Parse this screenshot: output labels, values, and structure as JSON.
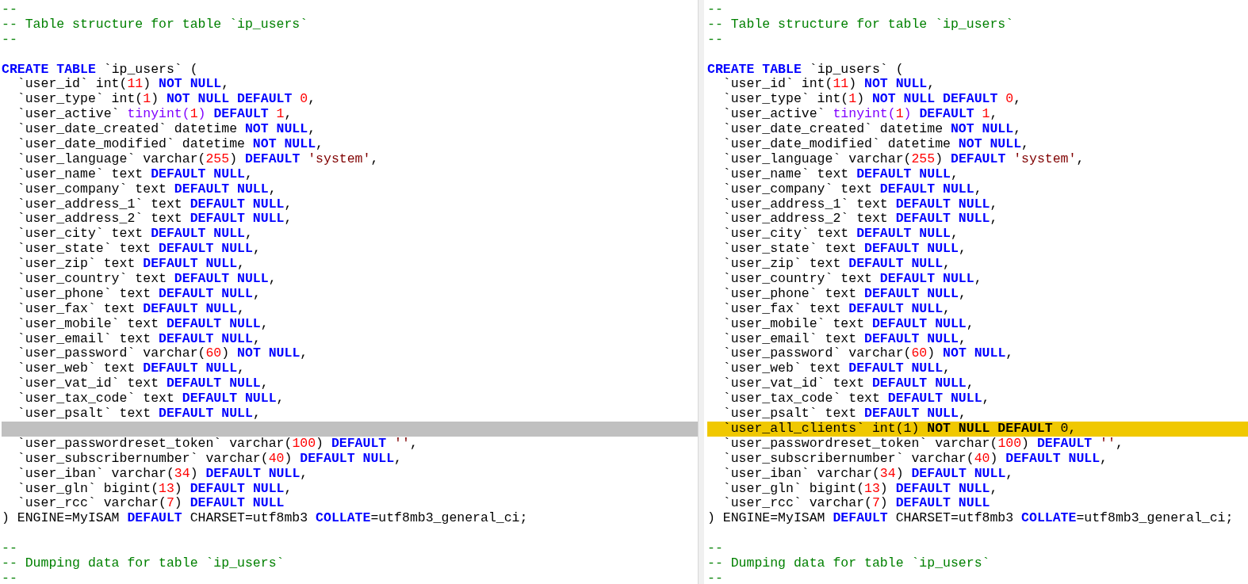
{
  "panes": [
    {
      "lines": [
        {
          "kind": "code",
          "tokens": [
            {
              "kind": "comment",
              "text": "--"
            }
          ]
        },
        {
          "kind": "code",
          "tokens": [
            {
              "kind": "comment",
              "text": "-- Table structure for table `ip_users`"
            }
          ]
        },
        {
          "kind": "code",
          "tokens": [
            {
              "kind": "comment",
              "text": "--"
            }
          ]
        },
        {
          "kind": "blank"
        },
        {
          "kind": "code",
          "tokens": [
            {
              "kind": "kw",
              "text": "CREATE TABLE"
            },
            {
              "kind": "plain",
              "text": " `ip_users` ("
            }
          ]
        },
        {
          "kind": "code",
          "tokens": [
            {
              "kind": "plain",
              "text": "  `user_id` int("
            },
            {
              "kind": "num",
              "text": "11"
            },
            {
              "kind": "plain",
              "text": ") "
            },
            {
              "kind": "kw",
              "text": "NOT NULL"
            },
            {
              "kind": "plain",
              "text": ","
            }
          ]
        },
        {
          "kind": "code",
          "tokens": [
            {
              "kind": "plain",
              "text": "  `user_type` int("
            },
            {
              "kind": "num",
              "text": "1"
            },
            {
              "kind": "plain",
              "text": ") "
            },
            {
              "kind": "kw",
              "text": "NOT NULL DEFAULT"
            },
            {
              "kind": "num",
              "text": " 0"
            },
            {
              "kind": "plain",
              "text": ","
            }
          ]
        },
        {
          "kind": "code",
          "tokens": [
            {
              "kind": "plain",
              "text": "  `user_active` "
            },
            {
              "kind": "type",
              "text": "tinyint("
            },
            {
              "kind": "num",
              "text": "1"
            },
            {
              "kind": "type",
              "text": ") "
            },
            {
              "kind": "kw",
              "text": "DEFAULT"
            },
            {
              "kind": "num",
              "text": " 1"
            },
            {
              "kind": "plain",
              "text": ","
            }
          ]
        },
        {
          "kind": "code",
          "tokens": [
            {
              "kind": "plain",
              "text": "  `user_date_created` datetime "
            },
            {
              "kind": "kw",
              "text": "NOT NULL"
            },
            {
              "kind": "plain",
              "text": ","
            }
          ]
        },
        {
          "kind": "code",
          "tokens": [
            {
              "kind": "plain",
              "text": "  `user_date_modified` datetime "
            },
            {
              "kind": "kw",
              "text": "NOT NULL"
            },
            {
              "kind": "plain",
              "text": ","
            }
          ]
        },
        {
          "kind": "code",
          "tokens": [
            {
              "kind": "plain",
              "text": "  `user_language` varchar("
            },
            {
              "kind": "num",
              "text": "255"
            },
            {
              "kind": "plain",
              "text": ") "
            },
            {
              "kind": "kw",
              "text": "DEFAULT"
            },
            {
              "kind": "str",
              "text": " 'system'"
            },
            {
              "kind": "plain",
              "text": ","
            }
          ]
        },
        {
          "kind": "code",
          "tokens": [
            {
              "kind": "plain",
              "text": "  `user_name` text "
            },
            {
              "kind": "kw",
              "text": "DEFAULT NULL"
            },
            {
              "kind": "plain",
              "text": ","
            }
          ]
        },
        {
          "kind": "code",
          "tokens": [
            {
              "kind": "plain",
              "text": "  `user_company` text "
            },
            {
              "kind": "kw",
              "text": "DEFAULT NULL"
            },
            {
              "kind": "plain",
              "text": ","
            }
          ]
        },
        {
          "kind": "code",
          "tokens": [
            {
              "kind": "plain",
              "text": "  `user_address_1` text "
            },
            {
              "kind": "kw",
              "text": "DEFAULT NULL"
            },
            {
              "kind": "plain",
              "text": ","
            }
          ]
        },
        {
          "kind": "code",
          "tokens": [
            {
              "kind": "plain",
              "text": "  `user_address_2` text "
            },
            {
              "kind": "kw",
              "text": "DEFAULT NULL"
            },
            {
              "kind": "plain",
              "text": ","
            }
          ]
        },
        {
          "kind": "code",
          "tokens": [
            {
              "kind": "plain",
              "text": "  `user_city` text "
            },
            {
              "kind": "kw",
              "text": "DEFAULT NULL"
            },
            {
              "kind": "plain",
              "text": ","
            }
          ]
        },
        {
          "kind": "code",
          "tokens": [
            {
              "kind": "plain",
              "text": "  `user_state` text "
            },
            {
              "kind": "kw",
              "text": "DEFAULT NULL"
            },
            {
              "kind": "plain",
              "text": ","
            }
          ]
        },
        {
          "kind": "code",
          "tokens": [
            {
              "kind": "plain",
              "text": "  `user_zip` text "
            },
            {
              "kind": "kw",
              "text": "DEFAULT NULL"
            },
            {
              "kind": "plain",
              "text": ","
            }
          ]
        },
        {
          "kind": "code",
          "tokens": [
            {
              "kind": "plain",
              "text": "  `user_country` text "
            },
            {
              "kind": "kw",
              "text": "DEFAULT NULL"
            },
            {
              "kind": "plain",
              "text": ","
            }
          ]
        },
        {
          "kind": "code",
          "tokens": [
            {
              "kind": "plain",
              "text": "  `user_phone` text "
            },
            {
              "kind": "kw",
              "text": "DEFAULT NULL"
            },
            {
              "kind": "plain",
              "text": ","
            }
          ]
        },
        {
          "kind": "code",
          "tokens": [
            {
              "kind": "plain",
              "text": "  `user_fax` text "
            },
            {
              "kind": "kw",
              "text": "DEFAULT NULL"
            },
            {
              "kind": "plain",
              "text": ","
            }
          ]
        },
        {
          "kind": "code",
          "tokens": [
            {
              "kind": "plain",
              "text": "  `user_mobile` text "
            },
            {
              "kind": "kw",
              "text": "DEFAULT NULL"
            },
            {
              "kind": "plain",
              "text": ","
            }
          ]
        },
        {
          "kind": "code",
          "tokens": [
            {
              "kind": "plain",
              "text": "  `user_email` text "
            },
            {
              "kind": "kw",
              "text": "DEFAULT NULL"
            },
            {
              "kind": "plain",
              "text": ","
            }
          ]
        },
        {
          "kind": "code",
          "tokens": [
            {
              "kind": "plain",
              "text": "  `user_password` varchar("
            },
            {
              "kind": "num",
              "text": "60"
            },
            {
              "kind": "plain",
              "text": ") "
            },
            {
              "kind": "kw",
              "text": "NOT NULL"
            },
            {
              "kind": "plain",
              "text": ","
            }
          ]
        },
        {
          "kind": "code",
          "tokens": [
            {
              "kind": "plain",
              "text": "  `user_web` text "
            },
            {
              "kind": "kw",
              "text": "DEFAULT NULL"
            },
            {
              "kind": "plain",
              "text": ","
            }
          ]
        },
        {
          "kind": "code",
          "tokens": [
            {
              "kind": "plain",
              "text": "  `user_vat_id` text "
            },
            {
              "kind": "kw",
              "text": "DEFAULT NULL"
            },
            {
              "kind": "plain",
              "text": ","
            }
          ]
        },
        {
          "kind": "code",
          "tokens": [
            {
              "kind": "plain",
              "text": "  `user_tax_code` text "
            },
            {
              "kind": "kw",
              "text": "DEFAULT NULL"
            },
            {
              "kind": "plain",
              "text": ","
            }
          ]
        },
        {
          "kind": "code",
          "tokens": [
            {
              "kind": "plain",
              "text": "  `user_psalt` text "
            },
            {
              "kind": "kw",
              "text": "DEFAULT NULL"
            },
            {
              "kind": "plain",
              "text": ","
            }
          ]
        },
        {
          "kind": "gap"
        },
        {
          "kind": "code",
          "tokens": [
            {
              "kind": "plain",
              "text": "  `user_passwordreset_token` varchar("
            },
            {
              "kind": "num",
              "text": "100"
            },
            {
              "kind": "plain",
              "text": ") "
            },
            {
              "kind": "kw",
              "text": "DEFAULT"
            },
            {
              "kind": "str",
              "text": " ''"
            },
            {
              "kind": "plain",
              "text": ","
            }
          ]
        },
        {
          "kind": "code",
          "tokens": [
            {
              "kind": "plain",
              "text": "  `user_subscribernumber` varchar("
            },
            {
              "kind": "num",
              "text": "40"
            },
            {
              "kind": "plain",
              "text": ") "
            },
            {
              "kind": "kw",
              "text": "DEFAULT NULL"
            },
            {
              "kind": "plain",
              "text": ","
            }
          ]
        },
        {
          "kind": "code",
          "tokens": [
            {
              "kind": "plain",
              "text": "  `user_iban` varchar("
            },
            {
              "kind": "num",
              "text": "34"
            },
            {
              "kind": "plain",
              "text": ") "
            },
            {
              "kind": "kw",
              "text": "DEFAULT NULL"
            },
            {
              "kind": "plain",
              "text": ","
            }
          ]
        },
        {
          "kind": "code",
          "tokens": [
            {
              "kind": "plain",
              "text": "  `user_gln` bigint("
            },
            {
              "kind": "num",
              "text": "13"
            },
            {
              "kind": "plain",
              "text": ") "
            },
            {
              "kind": "kw",
              "text": "DEFAULT NULL"
            },
            {
              "kind": "plain",
              "text": ","
            }
          ]
        },
        {
          "kind": "code",
          "tokens": [
            {
              "kind": "plain",
              "text": "  `user_rcc` varchar("
            },
            {
              "kind": "num",
              "text": "7"
            },
            {
              "kind": "plain",
              "text": ") "
            },
            {
              "kind": "kw",
              "text": "DEFAULT NULL"
            }
          ]
        },
        {
          "kind": "code",
          "tokens": [
            {
              "kind": "plain",
              "text": ") ENGINE=MyISAM "
            },
            {
              "kind": "kw",
              "text": "DEFAULT"
            },
            {
              "kind": "plain",
              "text": " CHARSET=utf8mb3 "
            },
            {
              "kind": "kw",
              "text": "COLLATE"
            },
            {
              "kind": "plain",
              "text": "=utf8mb3_general_ci;"
            }
          ]
        },
        {
          "kind": "blank"
        },
        {
          "kind": "code",
          "tokens": [
            {
              "kind": "comment",
              "text": "--"
            }
          ]
        },
        {
          "kind": "code",
          "tokens": [
            {
              "kind": "comment",
              "text": "-- Dumping data for table `ip_users`"
            }
          ]
        },
        {
          "kind": "code",
          "tokens": [
            {
              "kind": "comment",
              "text": "--"
            }
          ]
        }
      ]
    },
    {
      "lines": [
        {
          "kind": "code",
          "tokens": [
            {
              "kind": "comment",
              "text": "--"
            }
          ]
        },
        {
          "kind": "code",
          "tokens": [
            {
              "kind": "comment",
              "text": "-- Table structure for table `ip_users`"
            }
          ]
        },
        {
          "kind": "code",
          "tokens": [
            {
              "kind": "comment",
              "text": "--"
            }
          ]
        },
        {
          "kind": "blank"
        },
        {
          "kind": "code",
          "tokens": [
            {
              "kind": "kw",
              "text": "CREATE TABLE"
            },
            {
              "kind": "plain",
              "text": " `ip_users` ("
            }
          ]
        },
        {
          "kind": "code",
          "tokens": [
            {
              "kind": "plain",
              "text": "  `user_id` int("
            },
            {
              "kind": "num",
              "text": "11"
            },
            {
              "kind": "plain",
              "text": ") "
            },
            {
              "kind": "kw",
              "text": "NOT NULL"
            },
            {
              "kind": "plain",
              "text": ","
            }
          ]
        },
        {
          "kind": "code",
          "tokens": [
            {
              "kind": "plain",
              "text": "  `user_type` int("
            },
            {
              "kind": "num",
              "text": "1"
            },
            {
              "kind": "plain",
              "text": ") "
            },
            {
              "kind": "kw",
              "text": "NOT NULL DEFAULT"
            },
            {
              "kind": "num",
              "text": " 0"
            },
            {
              "kind": "plain",
              "text": ","
            }
          ]
        },
        {
          "kind": "code",
          "tokens": [
            {
              "kind": "plain",
              "text": "  `user_active` "
            },
            {
              "kind": "type",
              "text": "tinyint("
            },
            {
              "kind": "num",
              "text": "1"
            },
            {
              "kind": "type",
              "text": ") "
            },
            {
              "kind": "kw",
              "text": "DEFAULT"
            },
            {
              "kind": "num",
              "text": " 1"
            },
            {
              "kind": "plain",
              "text": ","
            }
          ]
        },
        {
          "kind": "code",
          "tokens": [
            {
              "kind": "plain",
              "text": "  `user_date_created` datetime "
            },
            {
              "kind": "kw",
              "text": "NOT NULL"
            },
            {
              "kind": "plain",
              "text": ","
            }
          ]
        },
        {
          "kind": "code",
          "tokens": [
            {
              "kind": "plain",
              "text": "  `user_date_modified` datetime "
            },
            {
              "kind": "kw",
              "text": "NOT NULL"
            },
            {
              "kind": "plain",
              "text": ","
            }
          ]
        },
        {
          "kind": "code",
          "tokens": [
            {
              "kind": "plain",
              "text": "  `user_language` varchar("
            },
            {
              "kind": "num",
              "text": "255"
            },
            {
              "kind": "plain",
              "text": ") "
            },
            {
              "kind": "kw",
              "text": "DEFAULT"
            },
            {
              "kind": "str",
              "text": " 'system'"
            },
            {
              "kind": "plain",
              "text": ","
            }
          ]
        },
        {
          "kind": "code",
          "tokens": [
            {
              "kind": "plain",
              "text": "  `user_name` text "
            },
            {
              "kind": "kw",
              "text": "DEFAULT NULL"
            },
            {
              "kind": "plain",
              "text": ","
            }
          ]
        },
        {
          "kind": "code",
          "tokens": [
            {
              "kind": "plain",
              "text": "  `user_company` text "
            },
            {
              "kind": "kw",
              "text": "DEFAULT NULL"
            },
            {
              "kind": "plain",
              "text": ","
            }
          ]
        },
        {
          "kind": "code",
          "tokens": [
            {
              "kind": "plain",
              "text": "  `user_address_1` text "
            },
            {
              "kind": "kw",
              "text": "DEFAULT NULL"
            },
            {
              "kind": "plain",
              "text": ","
            }
          ]
        },
        {
          "kind": "code",
          "tokens": [
            {
              "kind": "plain",
              "text": "  `user_address_2` text "
            },
            {
              "kind": "kw",
              "text": "DEFAULT NULL"
            },
            {
              "kind": "plain",
              "text": ","
            }
          ]
        },
        {
          "kind": "code",
          "tokens": [
            {
              "kind": "plain",
              "text": "  `user_city` text "
            },
            {
              "kind": "kw",
              "text": "DEFAULT NULL"
            },
            {
              "kind": "plain",
              "text": ","
            }
          ]
        },
        {
          "kind": "code",
          "tokens": [
            {
              "kind": "plain",
              "text": "  `user_state` text "
            },
            {
              "kind": "kw",
              "text": "DEFAULT NULL"
            },
            {
              "kind": "plain",
              "text": ","
            }
          ]
        },
        {
          "kind": "code",
          "tokens": [
            {
              "kind": "plain",
              "text": "  `user_zip` text "
            },
            {
              "kind": "kw",
              "text": "DEFAULT NULL"
            },
            {
              "kind": "plain",
              "text": ","
            }
          ]
        },
        {
          "kind": "code",
          "tokens": [
            {
              "kind": "plain",
              "text": "  `user_country` text "
            },
            {
              "kind": "kw",
              "text": "DEFAULT NULL"
            },
            {
              "kind": "plain",
              "text": ","
            }
          ]
        },
        {
          "kind": "code",
          "tokens": [
            {
              "kind": "plain",
              "text": "  `user_phone` text "
            },
            {
              "kind": "kw",
              "text": "DEFAULT NULL"
            },
            {
              "kind": "plain",
              "text": ","
            }
          ]
        },
        {
          "kind": "code",
          "tokens": [
            {
              "kind": "plain",
              "text": "  `user_fax` text "
            },
            {
              "kind": "kw",
              "text": "DEFAULT NULL"
            },
            {
              "kind": "plain",
              "text": ","
            }
          ]
        },
        {
          "kind": "code",
          "tokens": [
            {
              "kind": "plain",
              "text": "  `user_mobile` text "
            },
            {
              "kind": "kw",
              "text": "DEFAULT NULL"
            },
            {
              "kind": "plain",
              "text": ","
            }
          ]
        },
        {
          "kind": "code",
          "tokens": [
            {
              "kind": "plain",
              "text": "  `user_email` text "
            },
            {
              "kind": "kw",
              "text": "DEFAULT NULL"
            },
            {
              "kind": "plain",
              "text": ","
            }
          ]
        },
        {
          "kind": "code",
          "tokens": [
            {
              "kind": "plain",
              "text": "  `user_password` varchar("
            },
            {
              "kind": "num",
              "text": "60"
            },
            {
              "kind": "plain",
              "text": ") "
            },
            {
              "kind": "kw",
              "text": "NOT NULL"
            },
            {
              "kind": "plain",
              "text": ","
            }
          ]
        },
        {
          "kind": "code",
          "tokens": [
            {
              "kind": "plain",
              "text": "  `user_web` text "
            },
            {
              "kind": "kw",
              "text": "DEFAULT NULL"
            },
            {
              "kind": "plain",
              "text": ","
            }
          ]
        },
        {
          "kind": "code",
          "tokens": [
            {
              "kind": "plain",
              "text": "  `user_vat_id` text "
            },
            {
              "kind": "kw",
              "text": "DEFAULT NULL"
            },
            {
              "kind": "plain",
              "text": ","
            }
          ]
        },
        {
          "kind": "code",
          "tokens": [
            {
              "kind": "plain",
              "text": "  `user_tax_code` text "
            },
            {
              "kind": "kw",
              "text": "DEFAULT NULL"
            },
            {
              "kind": "plain",
              "text": ","
            }
          ]
        },
        {
          "kind": "code",
          "tokens": [
            {
              "kind": "plain",
              "text": "  `user_psalt` text "
            },
            {
              "kind": "kw",
              "text": "DEFAULT NULL"
            },
            {
              "kind": "plain",
              "text": ","
            }
          ]
        },
        {
          "kind": "added",
          "tokens": [
            {
              "kind": "plain",
              "text": "  `user_all_clients` int(1) "
            },
            {
              "kind": "kw",
              "text": "NOT NULL DEFAULT"
            },
            {
              "kind": "plain",
              "text": " 0,"
            }
          ]
        },
        {
          "kind": "code",
          "tokens": [
            {
              "kind": "plain",
              "text": "  `user_passwordreset_token` varchar("
            },
            {
              "kind": "num",
              "text": "100"
            },
            {
              "kind": "plain",
              "text": ") "
            },
            {
              "kind": "kw",
              "text": "DEFAULT"
            },
            {
              "kind": "str",
              "text": " ''"
            },
            {
              "kind": "plain",
              "text": ","
            }
          ]
        },
        {
          "kind": "code",
          "tokens": [
            {
              "kind": "plain",
              "text": "  `user_subscribernumber` varchar("
            },
            {
              "kind": "num",
              "text": "40"
            },
            {
              "kind": "plain",
              "text": ") "
            },
            {
              "kind": "kw",
              "text": "DEFAULT NULL"
            },
            {
              "kind": "plain",
              "text": ","
            }
          ]
        },
        {
          "kind": "code",
          "tokens": [
            {
              "kind": "plain",
              "text": "  `user_iban` varchar("
            },
            {
              "kind": "num",
              "text": "34"
            },
            {
              "kind": "plain",
              "text": ") "
            },
            {
              "kind": "kw",
              "text": "DEFAULT NULL"
            },
            {
              "kind": "plain",
              "text": ","
            }
          ]
        },
        {
          "kind": "code",
          "tokens": [
            {
              "kind": "plain",
              "text": "  `user_gln` bigint("
            },
            {
              "kind": "num",
              "text": "13"
            },
            {
              "kind": "plain",
              "text": ") "
            },
            {
              "kind": "kw",
              "text": "DEFAULT NULL"
            },
            {
              "kind": "plain",
              "text": ","
            }
          ]
        },
        {
          "kind": "code",
          "tokens": [
            {
              "kind": "plain",
              "text": "  `user_rcc` varchar("
            },
            {
              "kind": "num",
              "text": "7"
            },
            {
              "kind": "plain",
              "text": ") "
            },
            {
              "kind": "kw",
              "text": "DEFAULT NULL"
            }
          ]
        },
        {
          "kind": "code",
          "tokens": [
            {
              "kind": "plain",
              "text": ") ENGINE=MyISAM "
            },
            {
              "kind": "kw",
              "text": "DEFAULT"
            },
            {
              "kind": "plain",
              "text": " CHARSET=utf8mb3 "
            },
            {
              "kind": "kw",
              "text": "COLLATE"
            },
            {
              "kind": "plain",
              "text": "=utf8mb3_general_ci;"
            }
          ]
        },
        {
          "kind": "blank"
        },
        {
          "kind": "code",
          "tokens": [
            {
              "kind": "comment",
              "text": "--"
            }
          ]
        },
        {
          "kind": "code",
          "tokens": [
            {
              "kind": "comment",
              "text": "-- Dumping data for table `ip_users`"
            }
          ]
        },
        {
          "kind": "code",
          "tokens": [
            {
              "kind": "comment",
              "text": "--"
            }
          ]
        }
      ]
    }
  ]
}
